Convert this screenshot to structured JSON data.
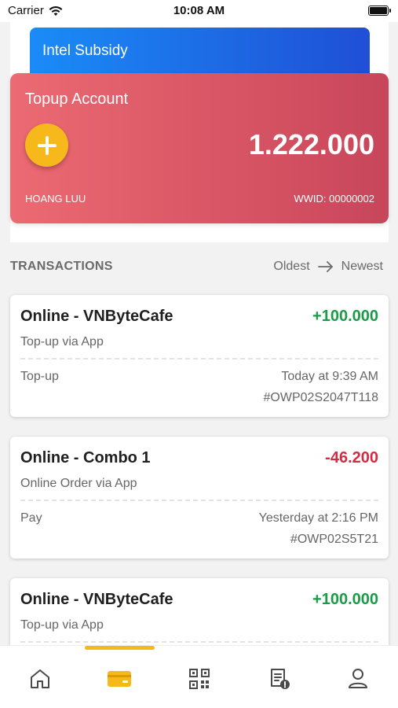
{
  "status_bar": {
    "carrier": "Carrier",
    "time": "10:08 AM",
    "icons": [
      "wifi-icon",
      "battery-icon"
    ]
  },
  "cards": {
    "secondary": {
      "title": "Intel Subsidy",
      "color": "#1f6fe6"
    },
    "primary": {
      "title": "Topup Account",
      "balance": "1.222.000",
      "holder": "HOANG LUU",
      "wwid": "WWID: 00000002",
      "color": "#e05a68",
      "add_icon": "plus-icon"
    }
  },
  "transactions": {
    "title": "TRANSACTIONS",
    "sort": {
      "from": "Oldest",
      "to": "Newest",
      "icon": "arrow-right-icon"
    },
    "items": [
      {
        "name": "Online - VNByteCafe",
        "amount": "+100.000",
        "sign": "positive",
        "subtitle": "Top-up via App",
        "type": "Top-up",
        "time": "Today at 9:39 AM",
        "ref": "#OWP02S2047T118"
      },
      {
        "name": "Online - Combo 1",
        "amount": "-46.200",
        "sign": "negative",
        "subtitle": "Online Order via App",
        "type": "Pay",
        "time": "Yesterday at 2:16 PM",
        "ref": "#OWP02S5T21"
      },
      {
        "name": "Online - VNByteCafe",
        "amount": "+100.000",
        "sign": "positive",
        "subtitle": "Top-up via App",
        "type": "",
        "time": "",
        "ref": ""
      }
    ]
  },
  "tabbar": {
    "active": "wallet",
    "accent": "#f7b81c",
    "items": [
      {
        "id": "home",
        "icon": "home-icon"
      },
      {
        "id": "wallet",
        "icon": "wallet-card-icon"
      },
      {
        "id": "qr",
        "icon": "qr-code-icon"
      },
      {
        "id": "receipt",
        "icon": "receipt-icon"
      },
      {
        "id": "profile",
        "icon": "profile-icon"
      }
    ]
  }
}
